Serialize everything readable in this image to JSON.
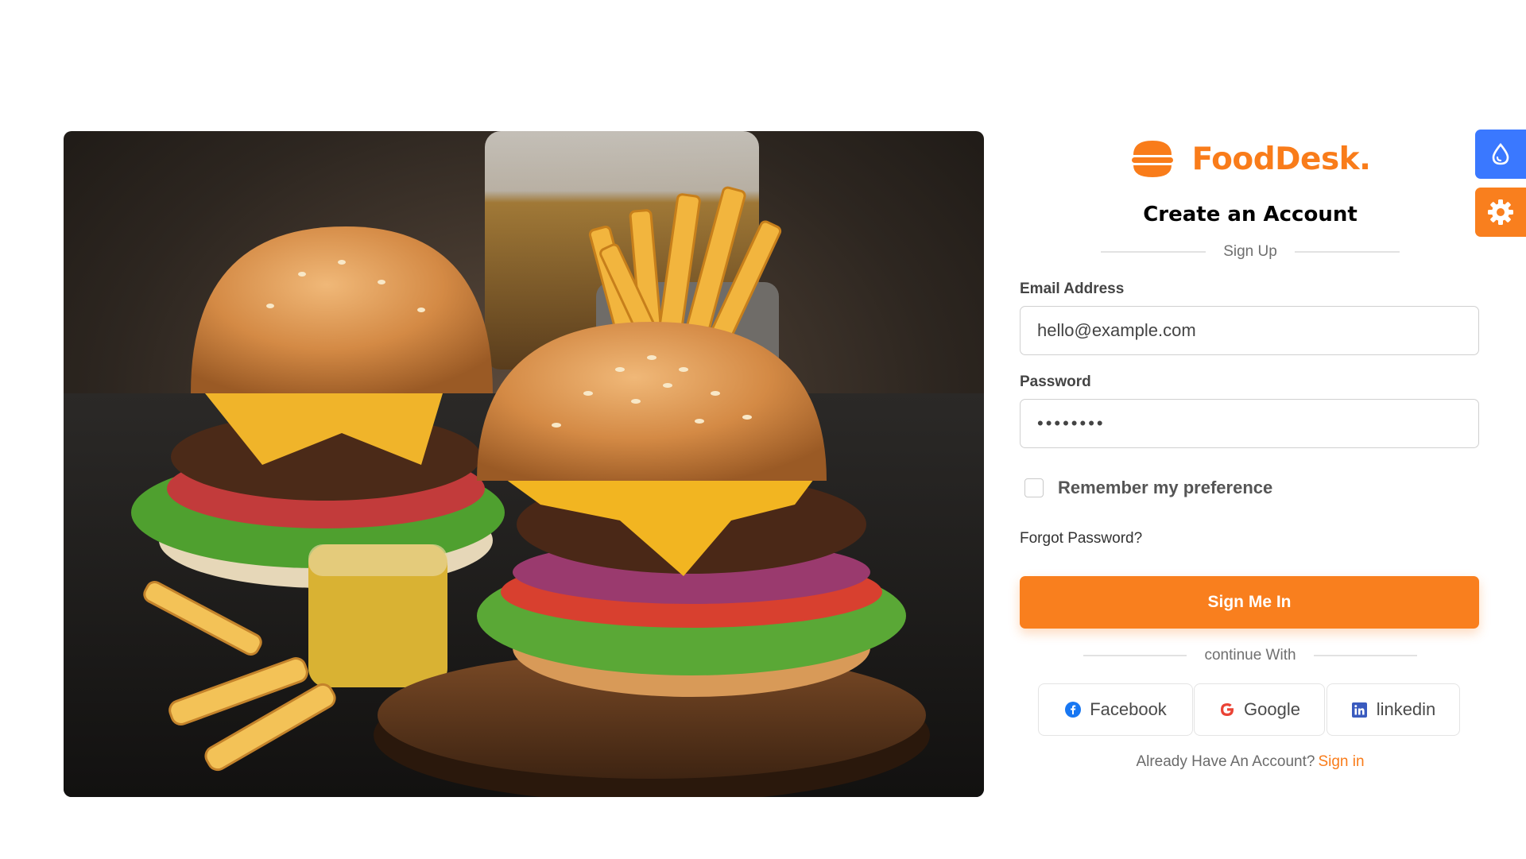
{
  "brand": {
    "name": "FoodDesk.",
    "accent": "#f97c1a"
  },
  "form": {
    "heading": "Create an Account",
    "subtitle": "Sign Up",
    "email": {
      "label": "Email Address",
      "value": "hello@example.com"
    },
    "password": {
      "label": "Password",
      "value": "••••••••"
    },
    "remember_label": "Remember my preference",
    "forgot_label": "Forgot Password?",
    "submit_label": "Sign Me In",
    "continue_label": "continue With"
  },
  "social": [
    {
      "label": "Facebook",
      "icon": "facebook-icon",
      "color": "#1877f2"
    },
    {
      "label": "Google",
      "icon": "google-icon",
      "color": "#ea4335"
    },
    {
      "label": "linkedin",
      "icon": "linkedin-icon",
      "color": "#0a66c2"
    }
  ],
  "footer": {
    "prompt": "Already Have An Account?",
    "link_label": "Sign in"
  },
  "side_buttons": [
    {
      "icon": "droplet-icon",
      "color": "#3a78ff"
    },
    {
      "icon": "gear-icon",
      "color": "#f97f1e"
    }
  ]
}
